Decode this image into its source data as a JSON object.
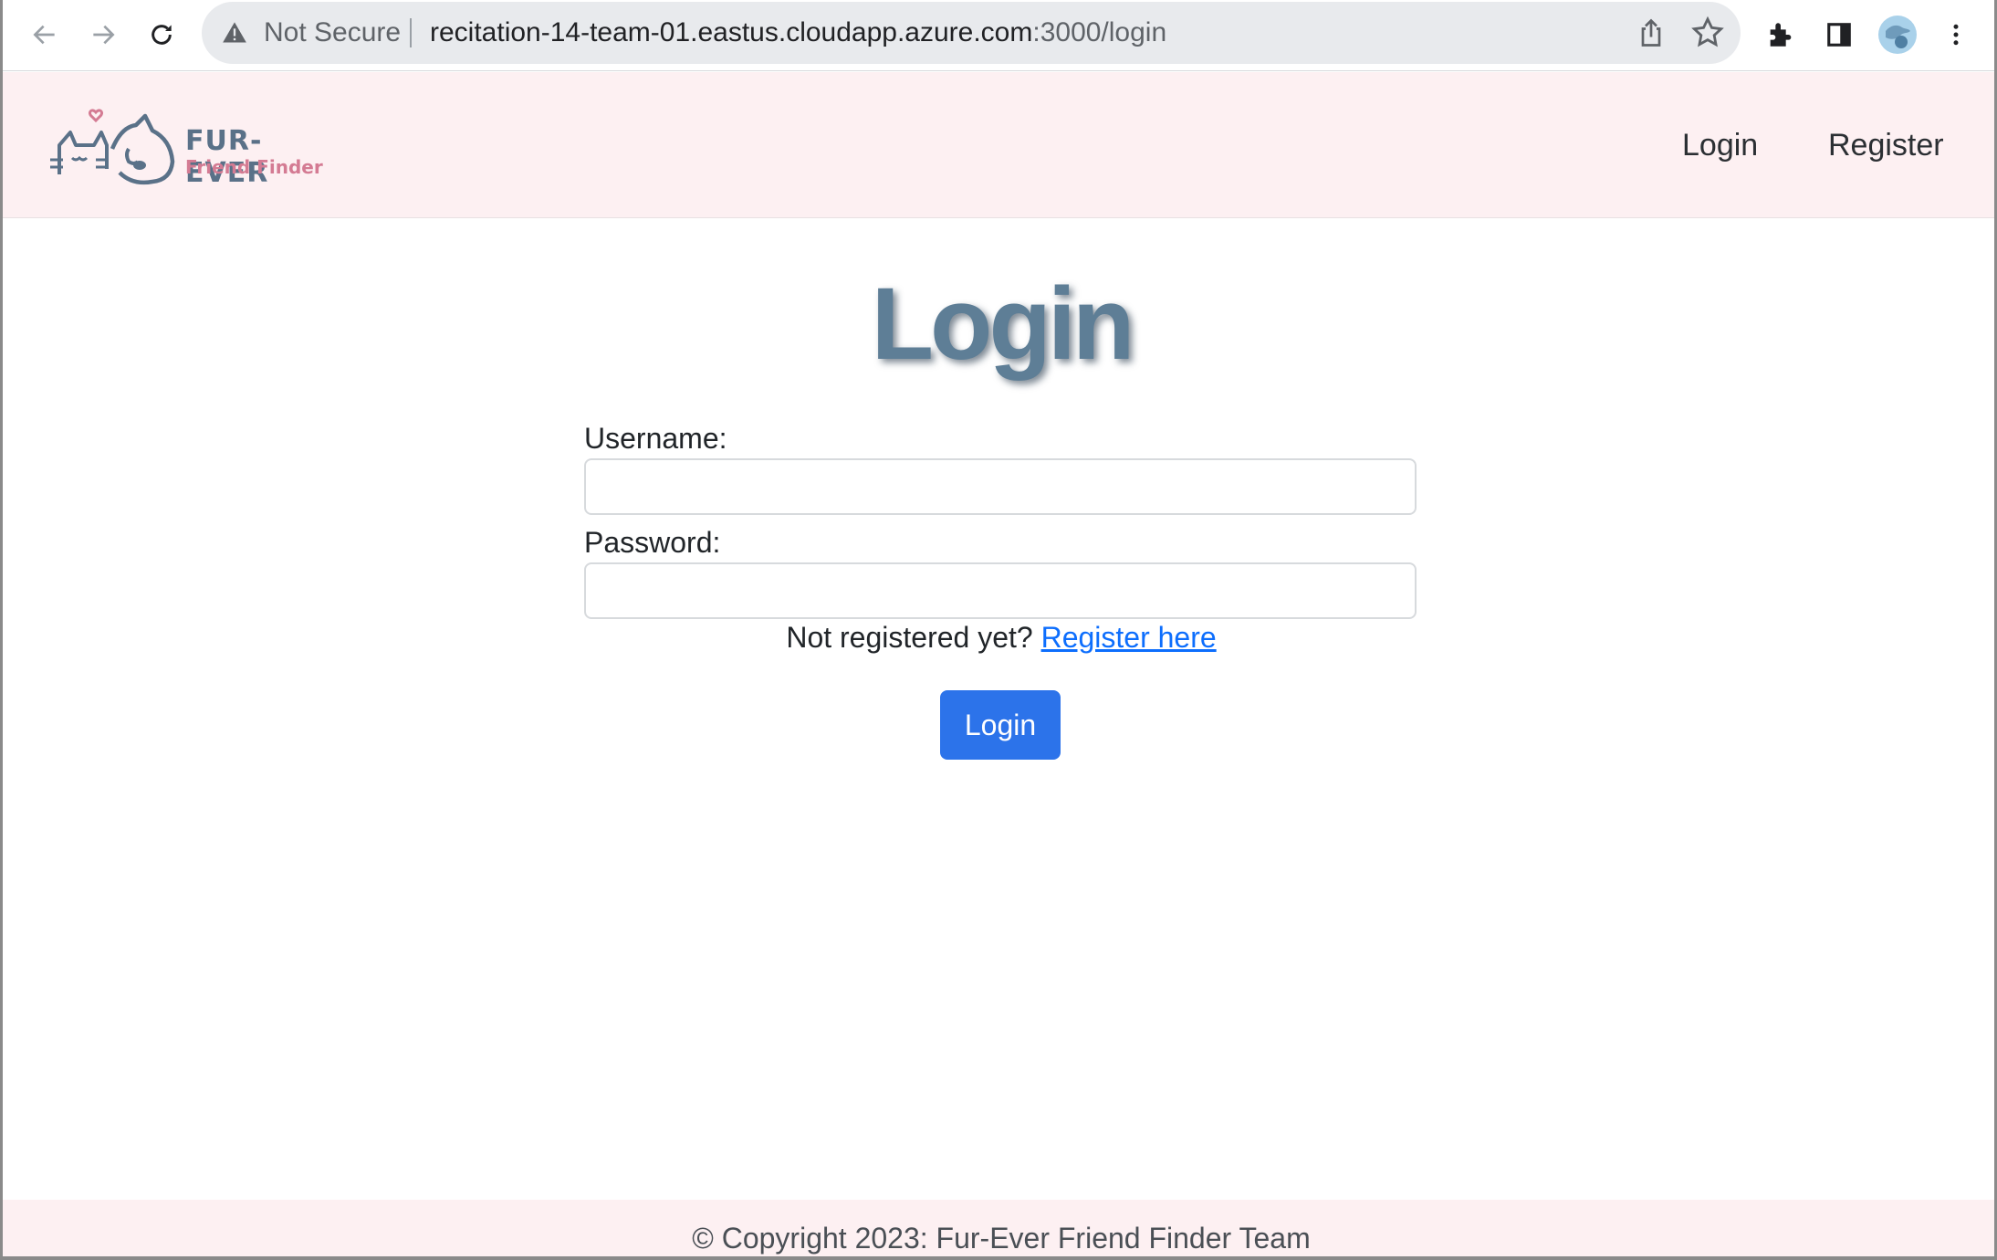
{
  "browser": {
    "security_label": "Not Secure",
    "url_main": "recitation-14-team-01.eastus.cloudapp.azure.com",
    "url_dim": ":3000/login",
    "icons": [
      "back-arrow-icon",
      "forward-arrow-icon",
      "reload-icon",
      "warning-icon",
      "share-icon",
      "star-icon",
      "extensions-icon",
      "side-panel-icon",
      "profile-avatar",
      "more-menu-icon"
    ]
  },
  "header": {
    "logo_title": "FUR-EVER",
    "logo_subtitle": "Friend Finder",
    "nav": {
      "login": "Login",
      "register": "Register"
    }
  },
  "main": {
    "title": "Login",
    "username_label": "Username:",
    "username_value": "",
    "password_label": "Password:",
    "password_value": "",
    "register_prompt": "Not registered yet?",
    "register_link": "Register here",
    "submit_label": "Login"
  },
  "footer": {
    "text": "© Copyright 2023: Fur-Ever Friend Finder Team"
  },
  "colors": {
    "header_bg": "#fdf0f2",
    "title": "#5e7e96",
    "button": "#2c73ea",
    "link": "#0d6efd",
    "logo_pink": "#d47b93"
  }
}
